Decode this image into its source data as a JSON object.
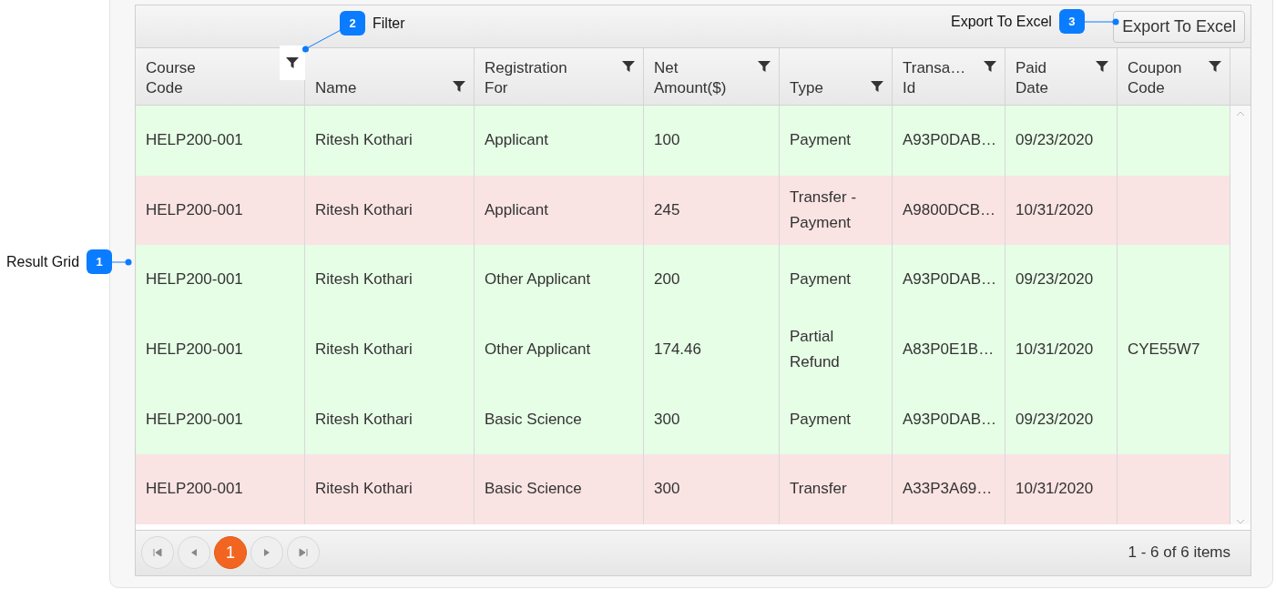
{
  "callouts": [
    {
      "number": "1",
      "label": "Result Grid"
    },
    {
      "number": "2",
      "label": "Filter"
    },
    {
      "number": "3",
      "label": "Export To Excel"
    }
  ],
  "toolbar": {
    "export_button": "Export To Excel"
  },
  "table": {
    "columns": [
      {
        "label": "Course Code",
        "highlighted": true
      },
      {
        "label": "Name",
        "highlighted": false
      },
      {
        "label": "Registration For",
        "highlighted": false
      },
      {
        "label": "Net Amount($)",
        "highlighted": false
      },
      {
        "label": "Type",
        "highlighted": false
      },
      {
        "label": "Transa… Id",
        "highlighted": false
      },
      {
        "label": "Paid Date",
        "highlighted": false
      },
      {
        "label": "Coupon Code",
        "highlighted": false
      }
    ],
    "rows": [
      {
        "color": "#e6fde6",
        "cells": [
          "HELP200-001",
          "Ritesh Kothari",
          "Applicant",
          "100",
          "Payment",
          "A93P0DAB…",
          "09/23/2020",
          ""
        ]
      },
      {
        "color": "#fae3e3",
        "cells": [
          "HELP200-001",
          "Ritesh Kothari",
          "Applicant",
          "245",
          "Transfer - Payment",
          "A9800DCB…",
          "10/31/2020",
          ""
        ]
      },
      {
        "color": "#e6fde6",
        "cells": [
          "HELP200-001",
          "Ritesh Kothari",
          "Other Applicant",
          "200",
          "Payment",
          "A93P0DAB…",
          "09/23/2020",
          ""
        ]
      },
      {
        "color": "#e6fde6",
        "cells": [
          "HELP200-001",
          "Ritesh Kothari",
          "Other Applicant",
          "174.46",
          "Partial Refund",
          "A83P0E1B…",
          "10/31/2020",
          "CYE55W7"
        ]
      },
      {
        "color": "#e6fde6",
        "cells": [
          "HELP200-001",
          "Ritesh Kothari",
          "Basic Science",
          "300",
          "Payment",
          "A93P0DAB…",
          "09/23/2020",
          ""
        ]
      },
      {
        "color": "#fae3e3",
        "cells": [
          "HELP200-001",
          "Ritesh Kothari",
          "Basic Science",
          "300",
          "Transfer",
          "A33P3A69…",
          "10/31/2020",
          ""
        ]
      }
    ]
  },
  "pager": {
    "pages": [
      {
        "label": "1",
        "selected": true
      }
    ],
    "summary": "1 - 6 of 6 items"
  }
}
